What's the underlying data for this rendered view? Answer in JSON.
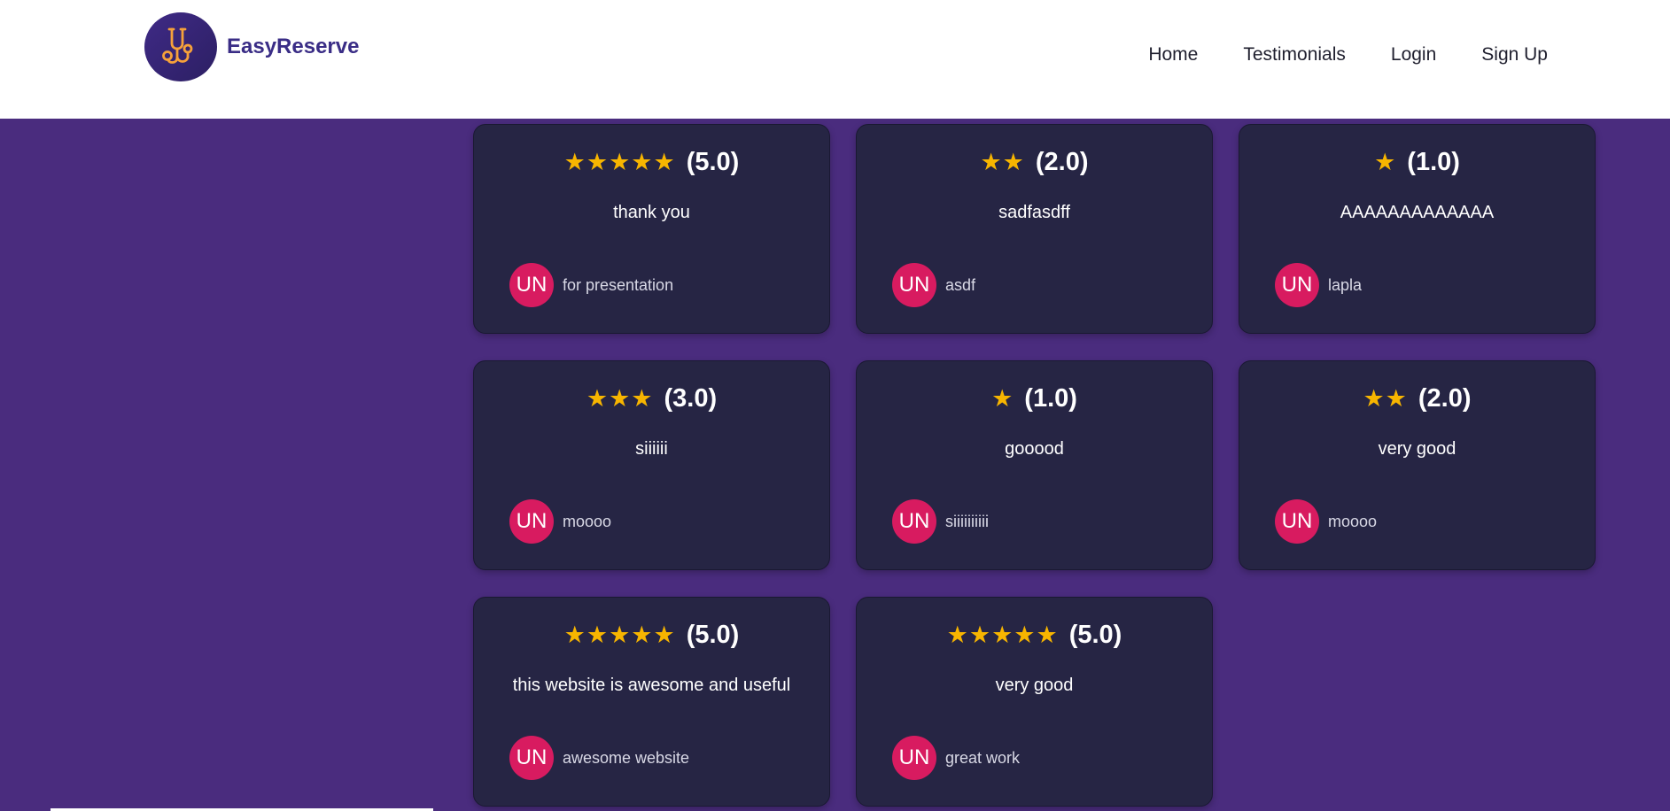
{
  "brand": {
    "name": "EasyReserve",
    "logo_icon": "stethoscope-icon"
  },
  "nav": {
    "items": [
      {
        "label": "Home"
      },
      {
        "label": "Testimonials"
      },
      {
        "label": "Login"
      },
      {
        "label": "Sign Up"
      }
    ]
  },
  "colors": {
    "page_background": "#4a2c7e",
    "card_background": "#262544",
    "star": "#f7b500",
    "avatar": "#d81b60",
    "brand_text": "#3a2d86",
    "logo_accent": "#f6a13a"
  },
  "testimonials": [
    {
      "stars": "★★★★★",
      "rating": 5.0,
      "rating_label": "(5.0)",
      "comment": "thank you",
      "avatar_initials": "UN",
      "author": "for presentation"
    },
    {
      "stars": "★★",
      "rating": 2.0,
      "rating_label": "(2.0)",
      "comment": "sadfasdff",
      "avatar_initials": "UN",
      "author": "asdf"
    },
    {
      "stars": "★",
      "rating": 1.0,
      "rating_label": "(1.0)",
      "comment": "AAAAAAAAAAAAA",
      "avatar_initials": "UN",
      "author": "lapla"
    },
    {
      "stars": "★★★",
      "rating": 3.0,
      "rating_label": "(3.0)",
      "comment": "siiiiii",
      "avatar_initials": "UN",
      "author": "moooo"
    },
    {
      "stars": "★",
      "rating": 1.0,
      "rating_label": "(1.0)",
      "comment": "gooood",
      "avatar_initials": "UN",
      "author": "siiiiiiiiii"
    },
    {
      "stars": "★★",
      "rating": 2.0,
      "rating_label": "(2.0)",
      "comment": "very good",
      "avatar_initials": "UN",
      "author": "moooo"
    },
    {
      "stars": "★★★★★",
      "rating": 5.0,
      "rating_label": "(5.0)",
      "comment": "this website is awesome and useful",
      "avatar_initials": "UN",
      "author": "awesome website"
    },
    {
      "stars": "★★★★★",
      "rating": 5.0,
      "rating_label": "(5.0)",
      "comment": "very good",
      "avatar_initials": "UN",
      "author": "great work"
    }
  ]
}
